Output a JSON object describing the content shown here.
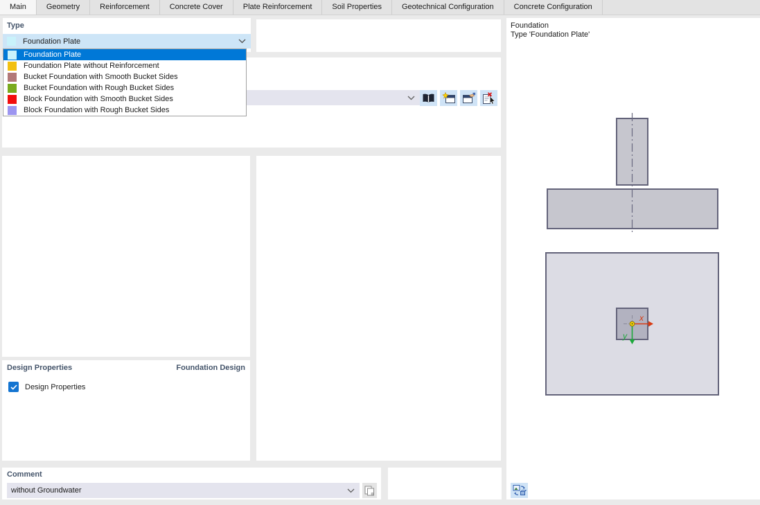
{
  "tabs": [
    {
      "label": "Main",
      "active": true
    },
    {
      "label": "Geometry",
      "active": false
    },
    {
      "label": "Reinforcement",
      "active": false
    },
    {
      "label": "Concrete Cover",
      "active": false
    },
    {
      "label": "Plate Reinforcement",
      "active": false
    },
    {
      "label": "Soil Properties",
      "active": false
    },
    {
      "label": "Geotechnical Configuration",
      "active": false
    },
    {
      "label": "Concrete Configuration",
      "active": false
    }
  ],
  "type_section": {
    "label": "Type",
    "selected_label": "Foundation Plate",
    "selected_color": "#c9f2fb",
    "options": [
      {
        "label": "Foundation Plate",
        "color": "#c9f2fb",
        "selected": true
      },
      {
        "label": "Foundation Plate without Reinforcement",
        "color": "#f2c011",
        "selected": false
      },
      {
        "label": "Bucket Foundation with Smooth Bucket Sides",
        "color": "#b27878",
        "selected": false
      },
      {
        "label": "Bucket Foundation with Rough Bucket Sides",
        "color": "#7aaa1e",
        "selected": false
      },
      {
        "label": "Block Foundation with Smooth Bucket Sides",
        "color": "#f20d0d",
        "selected": false
      },
      {
        "label": "Block Foundation with Rough Bucket Sides",
        "color": "#9c95f0",
        "selected": false
      }
    ]
  },
  "library_row": {
    "combo_value": "",
    "icons": [
      "library-book-icon",
      "new-entry-icon",
      "edit-entry-icon",
      "delete-entry-icon"
    ]
  },
  "design": {
    "header": "Design Properties",
    "header_right": "Foundation Design",
    "checkbox_label": "Design Properties",
    "checkbox_checked": true
  },
  "comment": {
    "header": "Comment",
    "value": "without Groundwater"
  },
  "preview": {
    "line1": "Foundation",
    "line2": "Type 'Foundation Plate'",
    "axis_x_label": "x",
    "axis_y_label": "y"
  },
  "colors": {
    "selection_blue": "#0078d7",
    "combo_focus_bg": "#cde5f7",
    "combo_bg": "#e4e4ee",
    "icon_tile_bg": "#cfe3f6",
    "checkbox_blue": "#1374d1",
    "axis_x_red": "#d83c14",
    "axis_y_green": "#1ea83c",
    "drawing_stroke": "#63637a",
    "drawing_fill": "#c6c6ce",
    "plan_plate_fill": "#dcdce4",
    "plan_column_fill": "#b2b2c0"
  }
}
